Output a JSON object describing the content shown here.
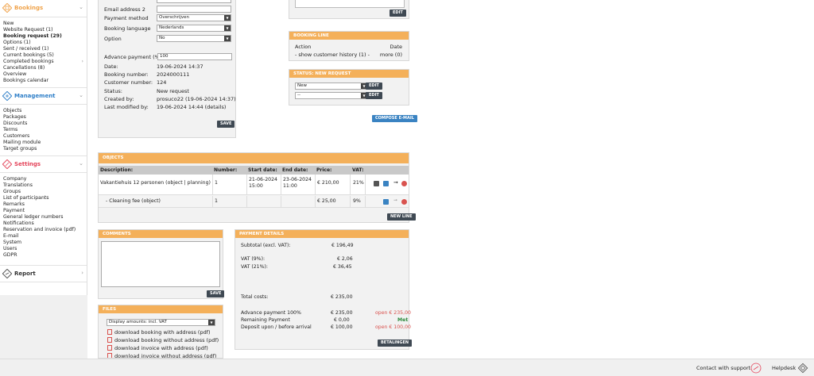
{
  "sidebar": {
    "bookings": {
      "title": "Bookings",
      "items": [
        {
          "label": "New",
          "bold": false
        },
        {
          "label": "Website Request (1)",
          "bold": false
        },
        {
          "label": "Booking request (29)",
          "bold": true
        },
        {
          "label": "Options (1)",
          "bold": false
        },
        {
          "label": "Sent / received (1)",
          "bold": false
        },
        {
          "label": "Current bookings (5)",
          "bold": false
        },
        {
          "label": "Completed bookings",
          "bold": false
        },
        {
          "label": "Cancellations (8)",
          "bold": false
        },
        {
          "label": "Overview",
          "bold": false
        },
        {
          "label": "Bookings calendar",
          "bold": false
        }
      ]
    },
    "management": {
      "title": "Management",
      "items": [
        "Objects",
        "Packages",
        "Discounts",
        "Terms",
        "Customers",
        "Mailing module",
        "Target groups"
      ]
    },
    "settings": {
      "title": "Settings",
      "items": [
        "Company",
        "Translations",
        "Groups",
        "List of participants",
        "Remarks",
        "Payment",
        "General ledger numbers",
        "Notifications",
        "Reservation and invoice (pdf)",
        "E-mail",
        "System",
        "Users",
        "GDPR"
      ]
    },
    "report": {
      "title": "Report"
    }
  },
  "booking": {
    "email2_label": "Email address 2",
    "email2_value": "",
    "payment_method_label": "Payment method",
    "payment_method_value": "Overschrijven",
    "booking_language_label": "Booking language",
    "booking_language_value": "Nederlands",
    "option_label": "Option",
    "option_value": "No",
    "advance_label": "Advance payment (%):",
    "advance_value": "100",
    "date_label": "Date:",
    "date_value": "19-06-2024 14:37",
    "booking_number_label": "Booking number:",
    "booking_number_value": "2024000111",
    "customer_number_label": "Customer number:",
    "customer_number_value": "124",
    "status_label": "Status:",
    "status_value": "New request",
    "created_label": "Created by:",
    "created_value": "prosuco22 (19-06-2024 14:37)",
    "modified_label": "Last modified by:",
    "modified_value": "19-06-2024 14:44 (details)",
    "save_label": "SAVE"
  },
  "right_top": {
    "edit_label": "EDIT"
  },
  "booking_line": {
    "title": "BOOKING LINE",
    "action_header": "Action",
    "date_header": "Date",
    "history_link": "- show customer history (1) -",
    "more_link": "more (0)"
  },
  "status_panel": {
    "title": "STATUS: NEW REQUEST",
    "status_select": "New",
    "second_select": "--",
    "edit_label": "EDIT"
  },
  "compose_email_label": "COMPOSE E-MAIL",
  "objects": {
    "title": "OBJECTS",
    "headers": {
      "description": "Description:",
      "number": "Number:",
      "start": "Start date:",
      "end": "End date:",
      "price": "Price:",
      "vat": "VAT:"
    },
    "rows": [
      {
        "description": "Vakantiehuis 12 personen (object | planning)",
        "number": "1",
        "start_date": "21-06-2024",
        "start_time": "15:00",
        "end_date": "23-06-2024",
        "end_time": "11:00",
        "price": "€ 210,00",
        "vat": "21%"
      },
      {
        "description": "- Cleaning fee (object)",
        "number": "1",
        "start_date": "",
        "start_time": "",
        "end_date": "",
        "end_time": "",
        "price": "€ 25,00",
        "vat": "9%"
      }
    ],
    "new_line_label": "NEW LINE"
  },
  "comments": {
    "title": "COMMENTS",
    "value": "",
    "save_label": "SAVE"
  },
  "files": {
    "title": "FILES",
    "display_select": "Display amounts: incl. VAT",
    "links": [
      "download booking with address (pdf)",
      "download booking without address (pdf)",
      "download invoice with address (pdf)",
      "download invoice without address (pdf)"
    ]
  },
  "payment": {
    "title": "PAYMENT DETAILS",
    "subtotal_label": "Subtotal (excl. VAT):",
    "subtotal_value": "€ 196,49",
    "vat9_label": "VAT (9%):",
    "vat9_value": "€ 2,06",
    "vat21_label": "VAT (21%):",
    "vat21_value": "€ 36,45",
    "total_label": "Total costs:",
    "total_value": "€ 235,00",
    "advance_label": "Advance payment 100%",
    "advance_value": "€ 235,00",
    "advance_status": "open € 235,00",
    "remaining_label": "Remaining Payment",
    "remaining_value": "€ 0,00",
    "remaining_status": "Met",
    "deposit_label": "Deposit upon / before arrival",
    "deposit_value": "€ 100,00",
    "deposit_status": "open € 100,00",
    "pay_button": "BETALINGEN"
  },
  "footer": {
    "support_label": "Contact with support",
    "helpdesk_label": "Helpdesk"
  },
  "colors": {
    "accent": "#f4b05a",
    "dark_button": "#3f4953",
    "blue_button": "#3a83c2",
    "danger": "#d9534f",
    "success": "#2e8b3d"
  }
}
